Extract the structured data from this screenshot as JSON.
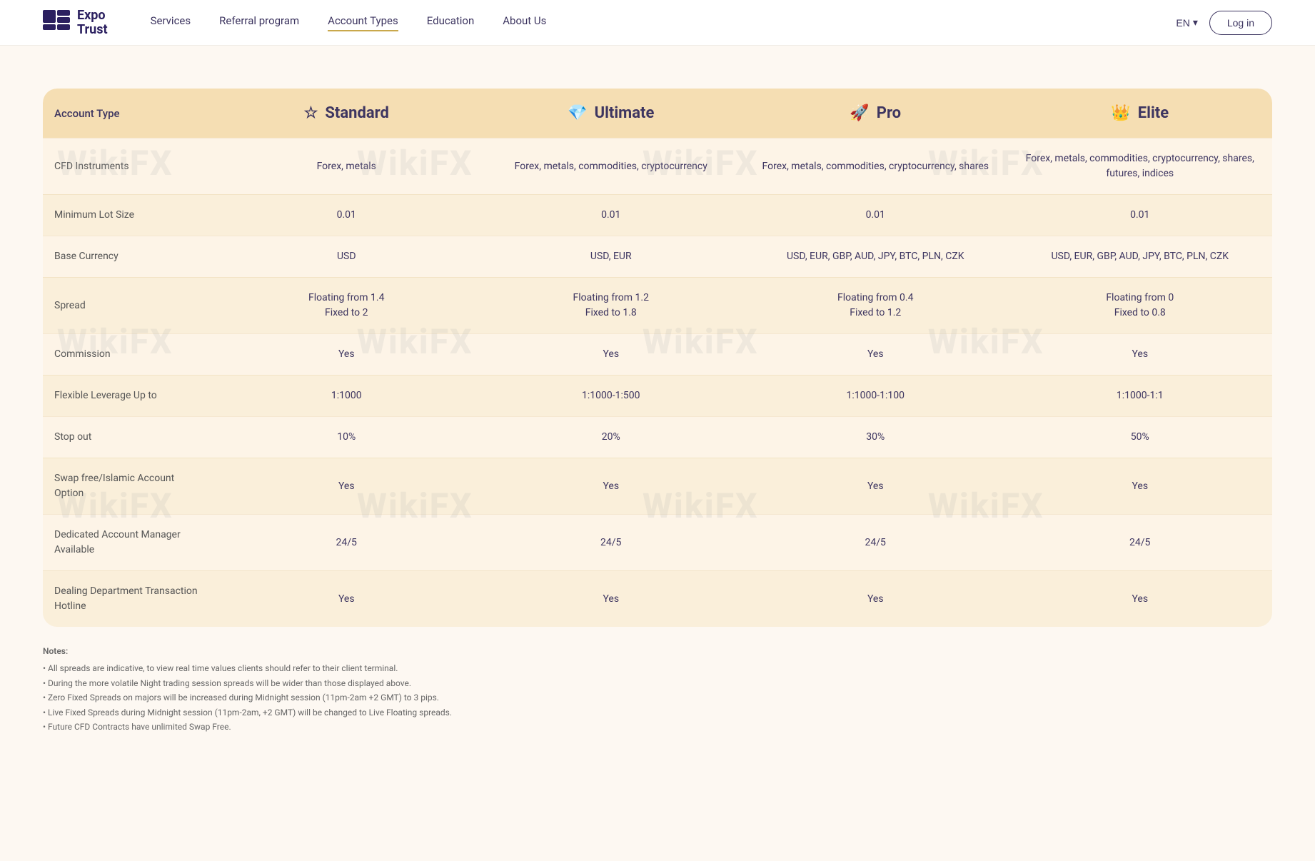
{
  "nav": {
    "logo_line1": "Expo",
    "logo_line2": "Trust",
    "links": [
      {
        "label": "Services",
        "active": false
      },
      {
        "label": "Referral program",
        "active": false
      },
      {
        "label": "Account Types",
        "active": true
      },
      {
        "label": "Education",
        "active": false
      },
      {
        "label": "About Us",
        "active": false
      }
    ],
    "lang": "EN",
    "login": "Log in"
  },
  "table": {
    "header": {
      "label": "Account Type",
      "columns": [
        {
          "icon": "☆",
          "label": "Standard"
        },
        {
          "icon": "💎",
          "label": "Ultimate"
        },
        {
          "icon": "🚀",
          "label": "Pro"
        },
        {
          "icon": "👑",
          "label": "Elite"
        }
      ]
    },
    "rows": [
      {
        "shaded": false,
        "label": "CFD Instruments",
        "values": [
          "Forex, metals",
          "Forex, metals, commodities, cryptocurrency",
          "Forex, metals, commodities, cryptocurrency, shares",
          "Forex, metals, commodities, cryptocurrency, shares, futures, indices"
        ]
      },
      {
        "shaded": true,
        "label": "Minimum Lot Size",
        "values": [
          "0.01",
          "0.01",
          "0.01",
          "0.01"
        ]
      },
      {
        "shaded": false,
        "label": "Base Currency",
        "values": [
          "USD",
          "USD, EUR",
          "USD, EUR, GBP, AUD, JPY, BTC, PLN, CZK",
          "USD, EUR, GBP, AUD, JPY, BTC, PLN, CZK"
        ]
      },
      {
        "shaded": true,
        "label": "Spread",
        "values": [
          "Floating from 1.4\nFixed to 2",
          "Floating from 1.2\nFixed to 1.8",
          "Floating from 0.4\nFixed to 1.2",
          "Floating from 0\nFixed to 0.8"
        ]
      },
      {
        "shaded": false,
        "label": "Commission",
        "values": [
          "Yes",
          "Yes",
          "Yes",
          "Yes"
        ]
      },
      {
        "shaded": true,
        "label": "Flexible Leverage Up to",
        "values": [
          "1:1000",
          "1:1000-1:500",
          "1:1000-1:100",
          "1:1000-1:1"
        ]
      },
      {
        "shaded": false,
        "label": "Stop out",
        "values": [
          "10%",
          "20%",
          "30%",
          "50%"
        ]
      },
      {
        "shaded": true,
        "label": "Swap free/Islamic Account Option",
        "values": [
          "Yes",
          "Yes",
          "Yes",
          "Yes"
        ]
      },
      {
        "shaded": false,
        "label": "Dedicated Account Manager Available",
        "values": [
          "24/5",
          "24/5",
          "24/5",
          "24/5"
        ]
      },
      {
        "shaded": true,
        "label": "Dealing Department Transaction Hotline",
        "values": [
          "Yes",
          "Yes",
          "Yes",
          "Yes"
        ]
      }
    ]
  },
  "notes": {
    "title": "Notes:",
    "lines": [
      "• All spreads are indicative, to view real time values clients should refer to their client terminal.",
      "• During the more volatile Night trading session spreads will be wider than those displayed above.",
      "• Zero Fixed Spreads on majors will be increased during Midnight session (11pm-2am +2 GMT) to 3 pips.",
      "• Live Fixed Spreads during Midnight session (11pm-2am, +2 GMT) will be changed to Live Floating spreads.",
      "• Future CFD Contracts have unlimited Swap Free."
    ]
  },
  "icons": {
    "standard": "☆",
    "ultimate": "💎",
    "pro": "🚀",
    "elite": "👑",
    "chevron_down": "▾"
  }
}
